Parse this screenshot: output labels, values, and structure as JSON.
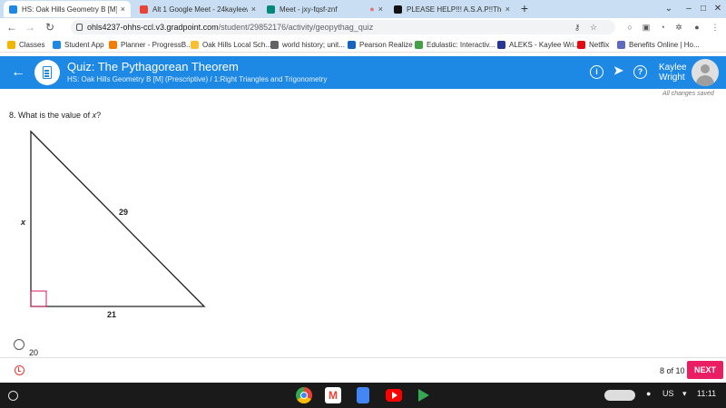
{
  "browser": {
    "tabs": [
      {
        "title": "HS: Oak Hills Geometry B [M] (P...",
        "favicon_color": "#1e88e5",
        "active": true
      },
      {
        "title": "Alt 1 Google Meet - 24kayleewrig...",
        "favicon_color": "#ea4335",
        "active": false
      },
      {
        "title": "Meet - jxy-fqsf-znf",
        "favicon_color": "#00897b",
        "active": false
      },
      {
        "title": "PLEASE HELP!!! A.S.A.P!!The Py...",
        "favicon_color": "#111111",
        "active": false
      }
    ],
    "tab_close_glyph": "×",
    "new_tab_glyph": "+",
    "url_domain": "ohls4237-ohhs-ccl.v3.gradpoint.com",
    "url_path": "/student/29852176/activity/geopythag_quiz"
  },
  "bookmarks": [
    {
      "label": "Classes",
      "color": "#f4b400"
    },
    {
      "label": "Student App",
      "color": "#1e88e5"
    },
    {
      "label": "Planner - ProgressB...",
      "color": "#f57c00"
    },
    {
      "label": "Oak Hills Local Sch...",
      "color": "#fbc02d"
    },
    {
      "label": "world history; unit...",
      "color": "#5f6368"
    },
    {
      "label": "Pearson Realize",
      "color": "#1565c0"
    },
    {
      "label": "Edulastic: Interactiv...",
      "color": "#43a047"
    },
    {
      "label": "ALEKS - Kaylee Wri...",
      "color": "#283593"
    },
    {
      "label": "Netflix",
      "color": "#e50914"
    },
    {
      "label": "Benefits Online | Ho...",
      "color": "#5c6bc0"
    }
  ],
  "header": {
    "title": "Quiz: The Pythagorean Theorem",
    "subtitle": "HS: Oak Hills Geometry B [M] (Prescriptive) / 1:Right Triangles and Trigonometry",
    "user_first": "Kaylee",
    "user_last": "Wright",
    "saved_status": "All changes saved"
  },
  "question": {
    "number": "8.",
    "text_before": "What is the value of",
    "variable": "x",
    "text_after": "?",
    "label_side": "x",
    "label_hypotenuse": "29",
    "label_base": "21"
  },
  "choices": [
    {
      "label": "20"
    }
  ],
  "footer": {
    "page_count": "8 of 10",
    "next_label": "NEXT"
  },
  "shelf": {
    "locale": "US",
    "time": "11:11"
  },
  "colors": {
    "header_blue": "#1e88e5",
    "next_button": "#e91e63"
  }
}
